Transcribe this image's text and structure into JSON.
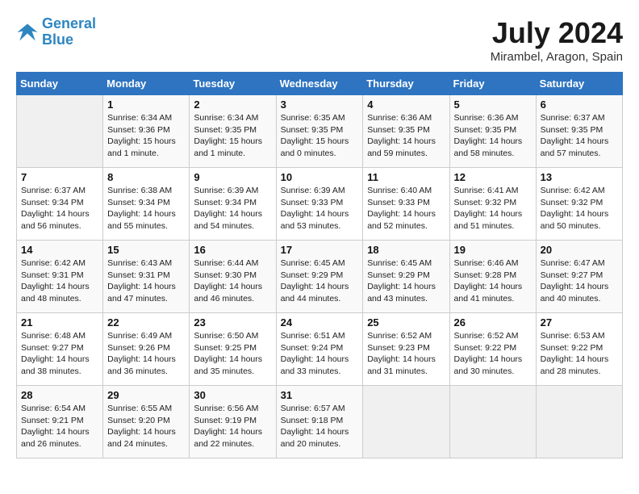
{
  "header": {
    "logo_line1": "General",
    "logo_line2": "Blue",
    "month": "July 2024",
    "location": "Mirambel, Aragon, Spain"
  },
  "weekdays": [
    "Sunday",
    "Monday",
    "Tuesday",
    "Wednesday",
    "Thursday",
    "Friday",
    "Saturday"
  ],
  "weeks": [
    [
      {
        "day": "",
        "info": ""
      },
      {
        "day": "1",
        "info": "Sunrise: 6:34 AM\nSunset: 9:36 PM\nDaylight: 15 hours\nand 1 minute."
      },
      {
        "day": "2",
        "info": "Sunrise: 6:34 AM\nSunset: 9:35 PM\nDaylight: 15 hours\nand 1 minute."
      },
      {
        "day": "3",
        "info": "Sunrise: 6:35 AM\nSunset: 9:35 PM\nDaylight: 15 hours\nand 0 minutes."
      },
      {
        "day": "4",
        "info": "Sunrise: 6:36 AM\nSunset: 9:35 PM\nDaylight: 14 hours\nand 59 minutes."
      },
      {
        "day": "5",
        "info": "Sunrise: 6:36 AM\nSunset: 9:35 PM\nDaylight: 14 hours\nand 58 minutes."
      },
      {
        "day": "6",
        "info": "Sunrise: 6:37 AM\nSunset: 9:35 PM\nDaylight: 14 hours\nand 57 minutes."
      }
    ],
    [
      {
        "day": "7",
        "info": "Sunrise: 6:37 AM\nSunset: 9:34 PM\nDaylight: 14 hours\nand 56 minutes."
      },
      {
        "day": "8",
        "info": "Sunrise: 6:38 AM\nSunset: 9:34 PM\nDaylight: 14 hours\nand 55 minutes."
      },
      {
        "day": "9",
        "info": "Sunrise: 6:39 AM\nSunset: 9:34 PM\nDaylight: 14 hours\nand 54 minutes."
      },
      {
        "day": "10",
        "info": "Sunrise: 6:39 AM\nSunset: 9:33 PM\nDaylight: 14 hours\nand 53 minutes."
      },
      {
        "day": "11",
        "info": "Sunrise: 6:40 AM\nSunset: 9:33 PM\nDaylight: 14 hours\nand 52 minutes."
      },
      {
        "day": "12",
        "info": "Sunrise: 6:41 AM\nSunset: 9:32 PM\nDaylight: 14 hours\nand 51 minutes."
      },
      {
        "day": "13",
        "info": "Sunrise: 6:42 AM\nSunset: 9:32 PM\nDaylight: 14 hours\nand 50 minutes."
      }
    ],
    [
      {
        "day": "14",
        "info": "Sunrise: 6:42 AM\nSunset: 9:31 PM\nDaylight: 14 hours\nand 48 minutes."
      },
      {
        "day": "15",
        "info": "Sunrise: 6:43 AM\nSunset: 9:31 PM\nDaylight: 14 hours\nand 47 minutes."
      },
      {
        "day": "16",
        "info": "Sunrise: 6:44 AM\nSunset: 9:30 PM\nDaylight: 14 hours\nand 46 minutes."
      },
      {
        "day": "17",
        "info": "Sunrise: 6:45 AM\nSunset: 9:29 PM\nDaylight: 14 hours\nand 44 minutes."
      },
      {
        "day": "18",
        "info": "Sunrise: 6:45 AM\nSunset: 9:29 PM\nDaylight: 14 hours\nand 43 minutes."
      },
      {
        "day": "19",
        "info": "Sunrise: 6:46 AM\nSunset: 9:28 PM\nDaylight: 14 hours\nand 41 minutes."
      },
      {
        "day": "20",
        "info": "Sunrise: 6:47 AM\nSunset: 9:27 PM\nDaylight: 14 hours\nand 40 minutes."
      }
    ],
    [
      {
        "day": "21",
        "info": "Sunrise: 6:48 AM\nSunset: 9:27 PM\nDaylight: 14 hours\nand 38 minutes."
      },
      {
        "day": "22",
        "info": "Sunrise: 6:49 AM\nSunset: 9:26 PM\nDaylight: 14 hours\nand 36 minutes."
      },
      {
        "day": "23",
        "info": "Sunrise: 6:50 AM\nSunset: 9:25 PM\nDaylight: 14 hours\nand 35 minutes."
      },
      {
        "day": "24",
        "info": "Sunrise: 6:51 AM\nSunset: 9:24 PM\nDaylight: 14 hours\nand 33 minutes."
      },
      {
        "day": "25",
        "info": "Sunrise: 6:52 AM\nSunset: 9:23 PM\nDaylight: 14 hours\nand 31 minutes."
      },
      {
        "day": "26",
        "info": "Sunrise: 6:52 AM\nSunset: 9:22 PM\nDaylight: 14 hours\nand 30 minutes."
      },
      {
        "day": "27",
        "info": "Sunrise: 6:53 AM\nSunset: 9:22 PM\nDaylight: 14 hours\nand 28 minutes."
      }
    ],
    [
      {
        "day": "28",
        "info": "Sunrise: 6:54 AM\nSunset: 9:21 PM\nDaylight: 14 hours\nand 26 minutes."
      },
      {
        "day": "29",
        "info": "Sunrise: 6:55 AM\nSunset: 9:20 PM\nDaylight: 14 hours\nand 24 minutes."
      },
      {
        "day": "30",
        "info": "Sunrise: 6:56 AM\nSunset: 9:19 PM\nDaylight: 14 hours\nand 22 minutes."
      },
      {
        "day": "31",
        "info": "Sunrise: 6:57 AM\nSunset: 9:18 PM\nDaylight: 14 hours\nand 20 minutes."
      },
      {
        "day": "",
        "info": ""
      },
      {
        "day": "",
        "info": ""
      },
      {
        "day": "",
        "info": ""
      }
    ]
  ]
}
